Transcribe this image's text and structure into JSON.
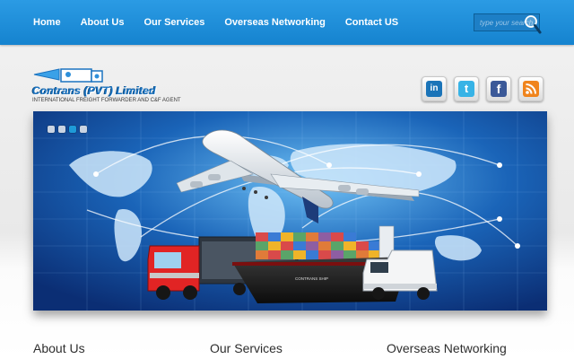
{
  "nav": {
    "items": [
      {
        "label": "Home"
      },
      {
        "label": "About Us"
      },
      {
        "label": "Our Services"
      },
      {
        "label": "Overseas Networking"
      },
      {
        "label": "Contact US"
      }
    ]
  },
  "search": {
    "placeholder": "type your search",
    "icon": "magnifier-icon"
  },
  "logo": {
    "name": "Contrans (PVT) Limited",
    "tagline": "INTERNATIONAL FREIGHT FORWARDER AND C&F AGENT"
  },
  "social": [
    {
      "name": "linkedin",
      "glyph": "in",
      "color": "#1b74b8"
    },
    {
      "name": "twitter",
      "glyph": "t",
      "color": "#37b3e6"
    },
    {
      "name": "facebook",
      "glyph": "f",
      "color": "#3b5998"
    },
    {
      "name": "rss",
      "glyph": "",
      "color": "#f0841c"
    }
  ],
  "banner": {
    "ship_name": "CONTRANS SHIP",
    "slides": 4,
    "active_slide": 3
  },
  "sections": [
    {
      "title": "About Us"
    },
    {
      "title": "Our Services"
    },
    {
      "title": "Overseas Networking"
    }
  ],
  "colors": {
    "nav_bg": "#1a8ad6",
    "brand_blue": "#1b73c0"
  }
}
